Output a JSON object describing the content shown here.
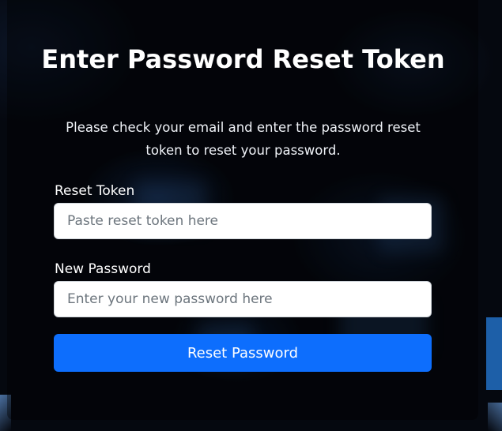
{
  "form": {
    "title": "Enter Password Reset Token",
    "subtitle": "Please check your email and enter the password reset token to reset your password.",
    "token_label": "Reset Token",
    "token_placeholder": "Paste reset token here",
    "token_value": "",
    "password_label": "New Password",
    "password_placeholder": "Enter your new password here",
    "password_value": "",
    "submit_label": "Reset Password"
  },
  "theme": {
    "accent": "#0d6efd",
    "background": "#05080f",
    "text": "#ffffff"
  }
}
